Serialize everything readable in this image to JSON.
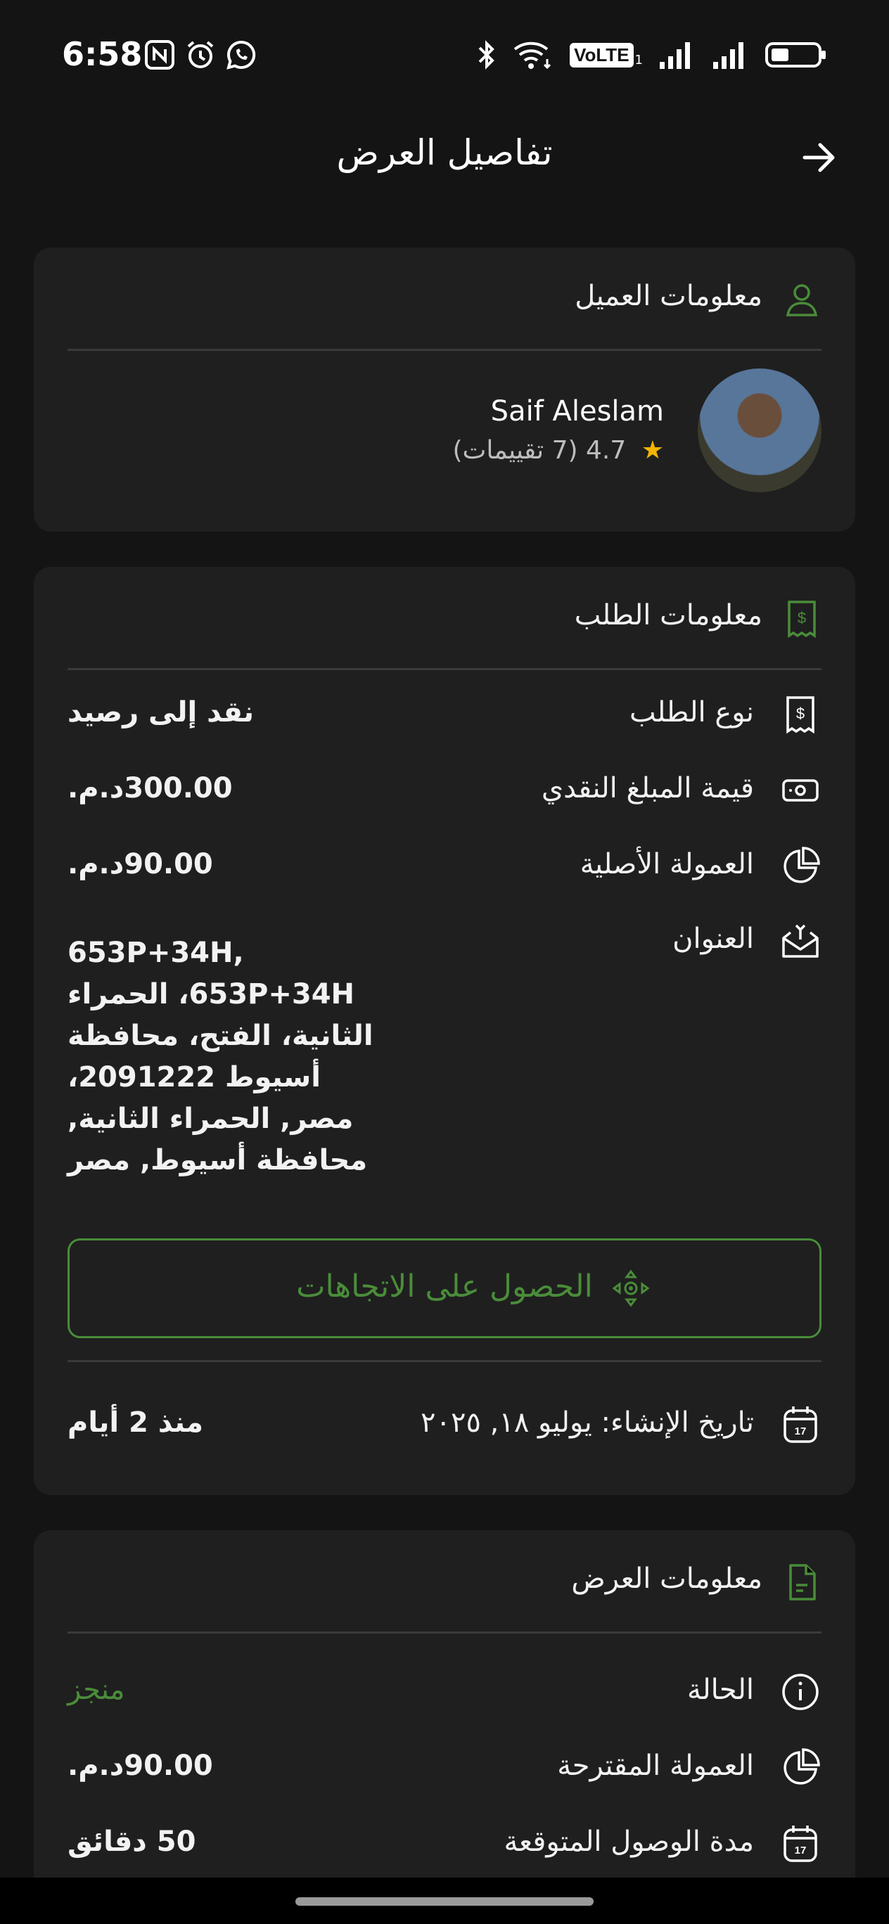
{
  "status_bar": {
    "time": "6:58",
    "volte_label": "VoLTE",
    "sim_label": "1",
    "icons": [
      "nfc-icon",
      "alarm-icon",
      "whatsapp-icon",
      "bluetooth-icon",
      "wifi-icon",
      "volte-icon",
      "signal-icon",
      "signal-icon",
      "battery-icon"
    ]
  },
  "header": {
    "title": "تفاصيل العرض",
    "back_icon": "arrow-right-icon"
  },
  "client_card": {
    "title": "معلومات العميل",
    "name": "Saif Aleslam",
    "rating": "4.7",
    "rating_count": "(7 تقييمات)"
  },
  "order_card": {
    "title": "معلومات الطلب",
    "rows": [
      {
        "label": "نوع الطلب",
        "value": "نقد إلى رصيد"
      },
      {
        "label": "قيمة المبلغ النقدي",
        "value": "300.00د.م."
      },
      {
        "label": "العمولة الأصلية",
        "value": "90.00د.م."
      },
      {
        "label": "العنوان",
        "value": "653P+34H, 653P+34H، الحمراء الثانية، الفتح، محافظة أسيوط 2091222، مصر, الحمراء الثانية, محافظة أسيوط, مصر"
      }
    ],
    "directions_button": "الحصول على الاتجاهات",
    "created_label": "تاريخ الإنشاء: يوليو ١٨, ٢٠٢٥",
    "created_ago": "منذ 2 أيام"
  },
  "offer_card": {
    "title": "معلومات العرض",
    "rows": [
      {
        "label": "الحالة",
        "value": "منجز"
      },
      {
        "label": "العمولة المقترحة",
        "value": "90.00د.م."
      },
      {
        "label": "مدة الوصول المتوقعة",
        "value": "50 دقائق"
      }
    ]
  },
  "colors": {
    "accent": "#4a8c3a",
    "background": "#141414",
    "card": "#1f1f1f",
    "star": "#f4b400"
  }
}
